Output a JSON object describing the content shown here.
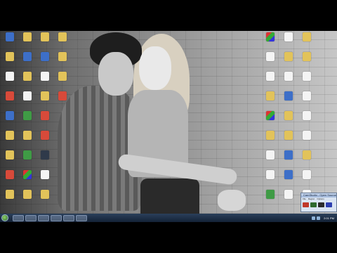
{
  "desktop": {
    "wallpaper": "black-and-white couple against brick wall",
    "left_icons": [
      {
        "label": "",
        "glyph": "g-blue"
      },
      {
        "label": "",
        "glyph": "g-folder"
      },
      {
        "label": "",
        "glyph": "g-doc"
      },
      {
        "label": "",
        "glyph": "g-red"
      },
      {
        "label": "",
        "glyph": "g-blue"
      },
      {
        "label": "",
        "glyph": "g-folder"
      },
      {
        "label": "",
        "glyph": "g-folder"
      },
      {
        "label": "",
        "glyph": "g-red"
      },
      {
        "label": "",
        "glyph": "g-folder"
      },
      {
        "label": "",
        "glyph": "g-folder"
      },
      {
        "label": "",
        "glyph": "g-blue"
      },
      {
        "label": "",
        "glyph": "g-folder"
      },
      {
        "label": "",
        "glyph": "g-doc"
      },
      {
        "label": "",
        "glyph": "g-green"
      },
      {
        "label": "",
        "glyph": "g-folder"
      },
      {
        "label": "",
        "glyph": "g-green"
      },
      {
        "label": "",
        "glyph": "g-mixed"
      },
      {
        "label": "",
        "glyph": "g-folder"
      },
      {
        "label": "",
        "glyph": "g-folder"
      },
      {
        "label": "",
        "glyph": "g-blue"
      },
      {
        "label": "",
        "glyph": "g-doc"
      },
      {
        "label": "",
        "glyph": "g-folder"
      },
      {
        "label": "",
        "glyph": "g-red"
      },
      {
        "label": "",
        "glyph": "g-red"
      },
      {
        "label": "",
        "glyph": "g-dark"
      },
      {
        "label": "",
        "glyph": "g-doc"
      },
      {
        "label": "",
        "glyph": "g-folder"
      },
      {
        "label": "",
        "glyph": "g-folder"
      },
      {
        "label": "",
        "glyph": "g-folder"
      },
      {
        "label": "",
        "glyph": "g-folder"
      },
      {
        "label": "",
        "glyph": "g-red"
      }
    ],
    "right_icons": [
      {
        "label": "",
        "glyph": "g-mixed"
      },
      {
        "label": "",
        "glyph": "g-doc"
      },
      {
        "label": "",
        "glyph": "g-doc"
      },
      {
        "label": "",
        "glyph": "g-folder"
      },
      {
        "label": "",
        "glyph": "g-mixed"
      },
      {
        "label": "",
        "glyph": "g-folder"
      },
      {
        "label": "",
        "glyph": "g-doc"
      },
      {
        "label": "",
        "glyph": "g-doc"
      },
      {
        "label": "",
        "glyph": "g-green"
      },
      {
        "label": "",
        "glyph": "g-doc"
      },
      {
        "label": "",
        "glyph": "g-folder"
      },
      {
        "label": "",
        "glyph": "g-doc"
      },
      {
        "label": "",
        "glyph": "g-blue"
      },
      {
        "label": "",
        "glyph": "g-folder"
      },
      {
        "label": "",
        "glyph": "g-folder"
      },
      {
        "label": "",
        "glyph": "g-blue"
      },
      {
        "label": "",
        "glyph": "g-blue"
      },
      {
        "label": "",
        "glyph": "g-doc"
      },
      {
        "label": "",
        "glyph": "g-folder"
      },
      {
        "label": "",
        "glyph": "g-folder"
      },
      {
        "label": "",
        "glyph": "g-doc"
      },
      {
        "label": "",
        "glyph": "g-doc"
      },
      {
        "label": "",
        "glyph": "g-doc"
      },
      {
        "label": "",
        "glyph": "g-doc"
      },
      {
        "label": "",
        "glyph": "g-folder"
      },
      {
        "label": "",
        "glyph": "g-doc"
      },
      {
        "label": "",
        "glyph": "g-doc"
      }
    ]
  },
  "mini_window": {
    "title": "CamStudio - Open Source",
    "menu": [
      "File",
      "Region",
      "Options"
    ],
    "tools": [
      "#c0392b",
      "#2d6a2d",
      "#2b2b2b",
      "#2d3fb0"
    ]
  },
  "taskbar": {
    "buttons": [
      "",
      "",
      "",
      "",
      "",
      ""
    ],
    "clock": "2:01 PM"
  }
}
